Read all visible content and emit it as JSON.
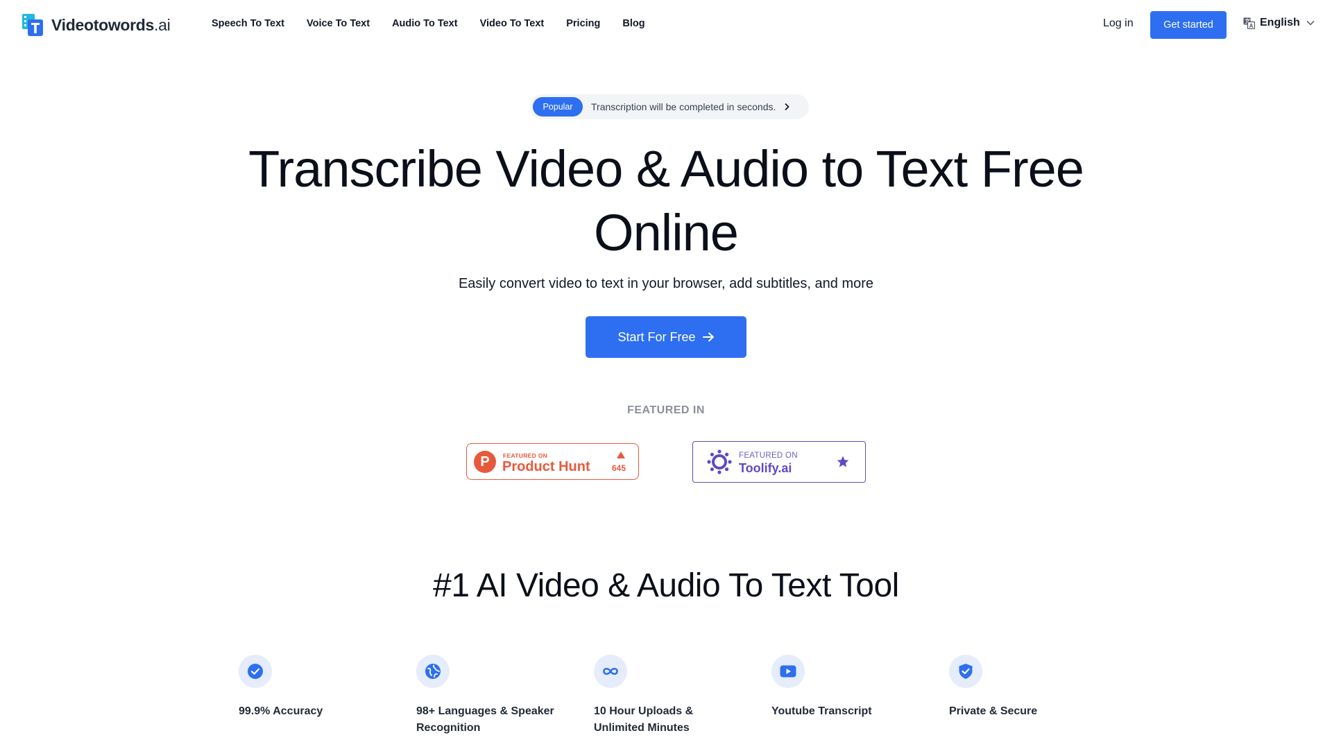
{
  "brand": {
    "name": "Videotowords",
    "suffix": ".ai",
    "accent": "#2d6ff0",
    "logo_colors": [
      "#2d6ff0",
      "#22b8e0"
    ]
  },
  "nav": {
    "items": [
      {
        "label": "Speech To Text"
      },
      {
        "label": "Voice To Text"
      },
      {
        "label": "Audio To Text"
      },
      {
        "label": "Video To Text"
      },
      {
        "label": "Pricing"
      },
      {
        "label": "Blog"
      }
    ],
    "login": "Log in",
    "get_started": "Get started",
    "language": "English"
  },
  "announcement": {
    "badge": "Popular",
    "text": "Transcription will be completed in seconds."
  },
  "hero": {
    "title_line1": "Transcribe Video & Audio to Text Free",
    "title_line2": "Online",
    "subtitle": "Easily convert video to text in your browser, add subtitles, and more",
    "cta": "Start For Free"
  },
  "featured": {
    "label": "FEATURED IN",
    "product_hunt": {
      "small": "FEATURED ON",
      "name": "Product Hunt",
      "icon_letter": "P",
      "upvotes": "645",
      "color": "#e8593b"
    },
    "toolify": {
      "small": "FEATURED ON",
      "name": "Toolify.ai",
      "color": "#5b4bc4"
    }
  },
  "features_section": {
    "title": "#1 AI Video & Audio To Text Tool",
    "items": [
      {
        "icon": "check-circle-icon",
        "label": "99.9% Accuracy"
      },
      {
        "icon": "globe-icon",
        "label": "98+ Languages & Speaker Recognition"
      },
      {
        "icon": "infinity-icon",
        "label": "10 Hour Uploads & Unlimited Minutes"
      },
      {
        "icon": "youtube-icon",
        "label": "Youtube Transcript"
      },
      {
        "icon": "shield-check-icon",
        "label": "Private & Secure"
      }
    ]
  }
}
